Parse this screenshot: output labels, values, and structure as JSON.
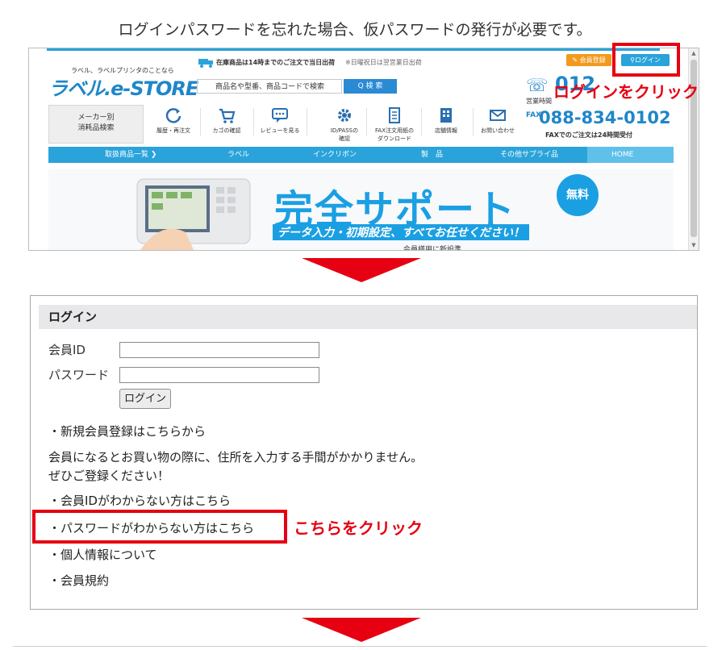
{
  "intro_text": "ログインパスワードを忘れた場合、仮パスワードの発行が必要です。",
  "site": {
    "tagline": "ラベル、ラベルプリンタのことなら",
    "logo": "ラベル.e-STORE",
    "shipping_notice": "在庫商品は14時までのご注文で当日出荷",
    "holiday_notice": "※日曜祝日は翌営業日出荷",
    "search_placeholder": "商品名や型番、商品コードで検索",
    "search_button": "Q 検 索",
    "member_register": "会員登録",
    "login_button": "ログイン",
    "phone_partial": "012",
    "hours_partial": "営業時間",
    "fax_label": "FAX",
    "fax_number": "088-834-0102",
    "fax_note": "FAXでのご注文は24時間受付",
    "maker_button": [
      "メーカー別",
      "消耗品検索"
    ],
    "icons": [
      {
        "label": "履歴・再注文",
        "icon": "refresh-icon"
      },
      {
        "label": "カゴの確認",
        "icon": "cart-icon"
      },
      {
        "label": "レビューを見る",
        "icon": "review-icon"
      },
      {
        "label": "ID/PASSの確認",
        "icon": "gear-icon"
      },
      {
        "label": "FAX注文用紙のダウンロード",
        "icon": "document-icon"
      },
      {
        "label": "店舗情報",
        "icon": "building-icon"
      },
      {
        "label": "お問い合わせ",
        "icon": "mail-icon"
      }
    ],
    "nav": [
      "取扱商品一覧",
      "ラベル",
      "インクリボン",
      "製　品",
      "その他サプライ品",
      "HOME"
    ],
    "banner_main": "完全サポート",
    "banner_badge": "無料",
    "banner_sub": "データ入力・初期設定、すべてお任せください！",
    "banner_sub2": "会員様用に新設準"
  },
  "annotations": {
    "login_click": "ログインをクリック",
    "password_click": "こちらをクリック"
  },
  "login_panel": {
    "title": "ログイン",
    "member_id_label": "会員ID",
    "password_label": "パスワード",
    "member_id_value": "",
    "password_value": "",
    "submit_label": "ログイン",
    "links": {
      "new_register": "・新規会員登録はこちらから",
      "forgot_id": "・会員IDがわからない方はこちら",
      "forgot_password": "・パスワードがわからない方はこちら",
      "privacy": "・個人情報について",
      "terms": "・会員規約"
    },
    "info_line1": "会員になるとお買い物の際に、住所を入力する手間がかかりません。",
    "info_line2": "ぜひご登録ください！"
  },
  "colors": {
    "accent_blue": "#2aa3da",
    "annotation_red": "#e60012",
    "orange": "#f29a1f"
  }
}
